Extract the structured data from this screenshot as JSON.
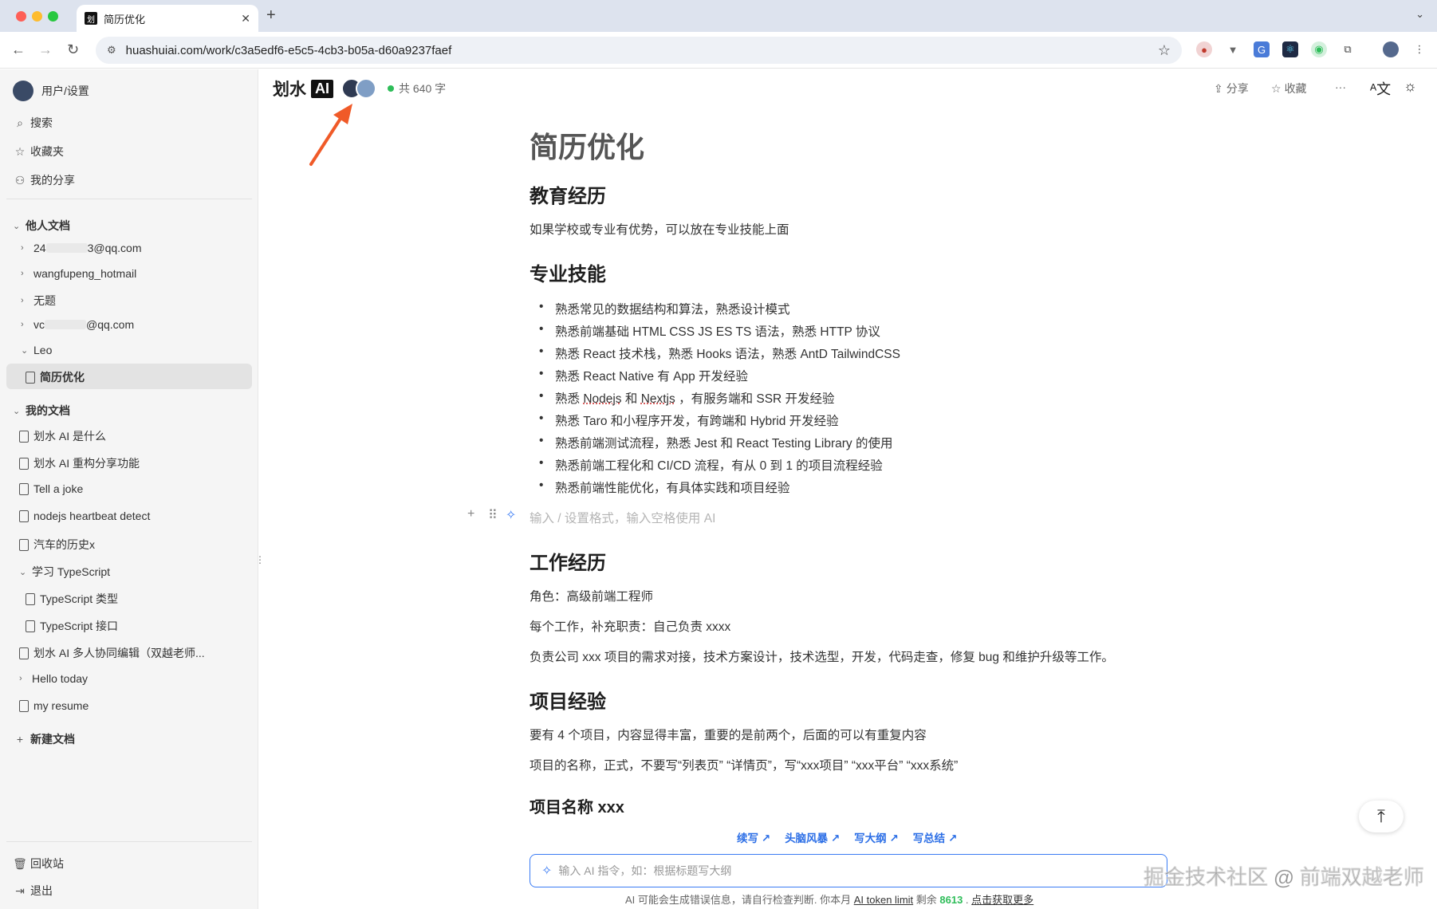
{
  "browser": {
    "tab_title": "简历优化",
    "tab_favicon": "划",
    "url": "huashuiai.com/work/c3a5edf6-e5c5-4cb3-b05a-d60a9237faef"
  },
  "sidebar": {
    "user_settings": "用户/设置",
    "search": "搜索",
    "favorites": "收藏夹",
    "my_shares": "我的分享",
    "others_section": "他人文档",
    "others": [
      {
        "label_prefix": "24",
        "label_suffix": "3@qq.com"
      },
      {
        "label": "wangfupeng_hotmail"
      },
      {
        "label": "无题"
      },
      {
        "label_prefix": "vc",
        "label_suffix": "@qq.com"
      },
      {
        "label": "Leo"
      }
    ],
    "active_doc": "简历优化",
    "my_section": "我的文档",
    "my_docs": [
      "划水 AI 是什么",
      "划水 AI 重构分享功能",
      "Tell a joke",
      "nodejs heartbeat detect",
      "汽车的历史x",
      "学习 TypeScript",
      "TypeScript 类型",
      "TypeScript 接口",
      "划水 AI 多人协同编辑（双越老师...",
      "Hello today",
      "my resume"
    ],
    "new_doc": "新建文档",
    "trash": "回收站",
    "logout": "退出"
  },
  "appbar": {
    "brand": "划水",
    "brand_badge": "AI",
    "word_count": "共 640 字",
    "share": "分享",
    "favorite": "收藏",
    "more": "···"
  },
  "document": {
    "title": "简历优化",
    "education_heading": "教育经历",
    "education_text": "如果学校或专业有优势，可以放在专业技能上面",
    "skills_heading": "专业技能",
    "skills": [
      "熟悉常见的数据结构和算法，熟悉设计模式",
      "熟悉前端基础 HTML CSS JS ES TS 语法，熟悉 HTTP 协议",
      "熟悉 React 技术栈，熟悉 Hooks 语法，熟悉 AntD TailwindCSS",
      "熟悉 React Native 有 App 开发经验",
      "熟悉 Taro 和小程序开发，有跨端和 Hybrid 开发经验",
      "熟悉前端测试流程，熟悉 Jest 和 React Testing Library 的使用",
      "熟悉前端工程化和 CI/CD 流程，有从 0 到 1 的项目流程经验",
      "熟悉前端性能优化，有具体实践和项目经验"
    ],
    "skill_node": {
      "a": "熟悉 ",
      "b": "Nodejs",
      "c": " 和 ",
      "d": "Nextjs",
      "e": " ，有服务端和 SSR 开发经验"
    },
    "placeholder": "输入 / 设置格式，输入空格使用 AI",
    "work_heading": "工作经历",
    "work_lines": [
      "角色：高级前端工程师",
      "每个工作，补充职责：自己负责 xxxx",
      "负责公司 xxx 项目的需求对接，技术方案设计，技术选型，开发，代码走查，修复 bug 和维护升级等工作。"
    ],
    "project_heading": "项目经验",
    "project_lines": [
      "要有 4 个项目，内容显得丰富，重要的是前两个，后面的可以有重复内容",
      "项目的名称，正式，不要写“列表页” “详情页”，写“xxx项目” “xxx平台” “xxx系统”"
    ],
    "project_name": "项目名称 xxx"
  },
  "ai": {
    "chips": [
      "续写 ↗",
      "头脑风暴 ↗",
      "写大纲 ↗",
      "写总结 ↗"
    ],
    "input_placeholder": "输入 AI 指令，如：根据标题写大纲",
    "foot_a": "AI 可能会生成错误信息，请自行检查判断. 你本月 ",
    "foot_link": "AI token limit",
    "foot_b": " 剩余 ",
    "foot_num": "8613",
    "foot_c": " . ",
    "foot_more": "点击获取更多"
  },
  "watermark": "掘金技术社区 @ 前端双越老师"
}
